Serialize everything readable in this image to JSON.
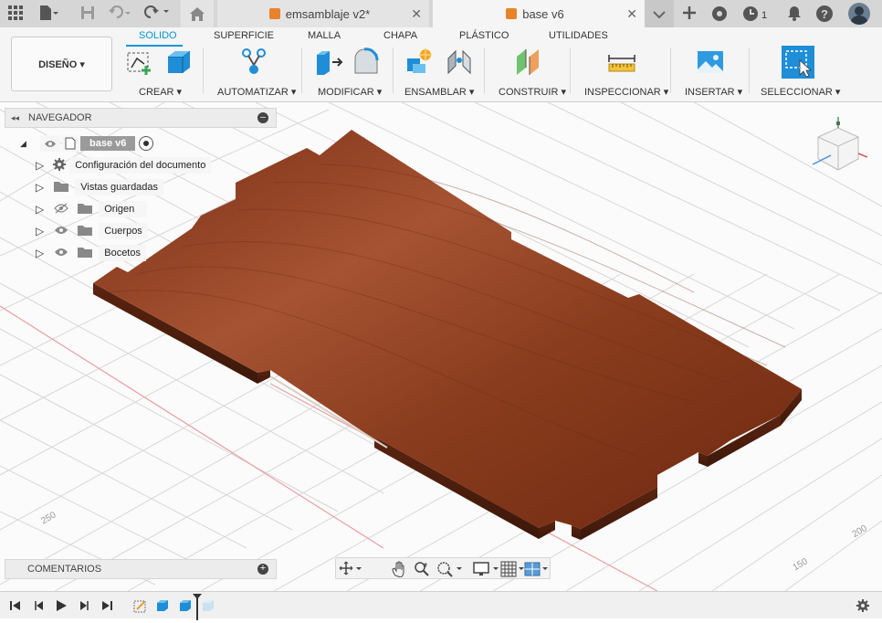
{
  "tabs": [
    {
      "label": "emsamblaje v2*",
      "active": false
    },
    {
      "label": "base v6",
      "active": true
    }
  ],
  "notifications": {
    "count": "1"
  },
  "mode": {
    "label": "DISEÑO ▾"
  },
  "top_tabs": [
    "SOLIDO",
    "SUPERFICIE",
    "MALLA",
    "CHAPA",
    "PLÁSTICO",
    "UTILIDADES"
  ],
  "tool_groups": [
    {
      "label": "CREAR ▾"
    },
    {
      "label": "AUTOMATIZAR ▾"
    },
    {
      "label": "MODIFICAR ▾"
    },
    {
      "label": "ENSAMBLAR ▾"
    },
    {
      "label": "CONSTRUIR ▾"
    },
    {
      "label": "INSPECCIONAR ▾"
    },
    {
      "label": "INSERTAR ▾"
    },
    {
      "label": "SELECCIONAR ▾"
    }
  ],
  "navigator": {
    "title": "NAVEGADOR",
    "root": "base v6",
    "items": [
      {
        "label": "Configuración del documento"
      },
      {
        "label": "Vistas guardadas"
      },
      {
        "label": "Origen"
      },
      {
        "label": "Cuerpos"
      },
      {
        "label": "Bocetos"
      }
    ]
  },
  "comments": {
    "title": "COMENTARIOS"
  },
  "grid_labels": {
    "left": "250",
    "right1": "200",
    "right2": "150"
  },
  "colors": {
    "accent": "#0696d7",
    "wood": "#8b3a1c",
    "tab_cube": "#e8832a"
  }
}
